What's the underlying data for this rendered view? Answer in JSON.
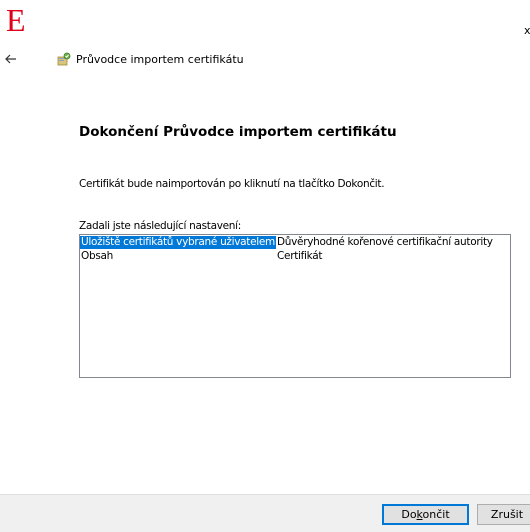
{
  "brand": {
    "logo_letter": "E",
    "logo_color": "#e0001b"
  },
  "window": {
    "close_glyph": "x",
    "title": "Průvodce importem certifikátu",
    "back_icon": "back-arrow-icon",
    "wizard_icon": "certificate-wizard-icon"
  },
  "main": {
    "heading": "Dokončení Průvodce importem certifikátu",
    "info_text": "Certifikát bude naimportován po kliknutí na tlačítko Dokončit.",
    "settings_label": "Zadali jste následující nastavení:",
    "settings": [
      {
        "key": "Úložiště certifikátů vybrané uživatelem",
        "value": "Důvěryhodné kořenové certifikační autority",
        "selected": true
      },
      {
        "key": "Obsah",
        "value": "Certifikát",
        "selected": false
      }
    ]
  },
  "footer": {
    "finish_pre": "Do",
    "finish_accel": "k",
    "finish_post": "ončit",
    "cancel_label": "Zrušit"
  },
  "colors": {
    "selection": "#0078d7",
    "footer_bg": "#f0f0f0",
    "button_bg": "#e1e1e1"
  }
}
